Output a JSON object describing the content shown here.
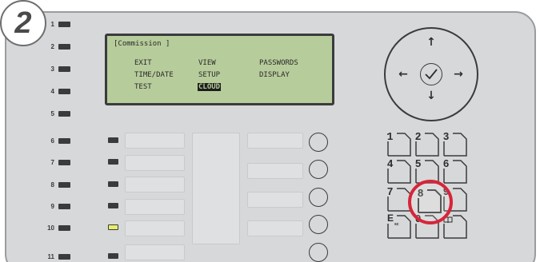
{
  "step_badge": "2",
  "status_leds": [
    {
      "label": "1"
    },
    {
      "label": "2"
    },
    {
      "label": "3"
    },
    {
      "label": "4"
    },
    {
      "label": "5"
    },
    {
      "label": "6"
    },
    {
      "label": "7"
    },
    {
      "label": "8"
    },
    {
      "label": "9"
    },
    {
      "label": "10"
    },
    {
      "label": "11"
    }
  ],
  "lcd": {
    "title": "[Commission ]",
    "menu": [
      {
        "label": "EXIT",
        "selected": false
      },
      {
        "label": "VIEW",
        "selected": false
      },
      {
        "label": "PASSWORDS",
        "selected": false
      },
      {
        "label": "TIME/DATE",
        "selected": false
      },
      {
        "label": "SETUP",
        "selected": false
      },
      {
        "label": "DISPLAY",
        "selected": false
      },
      {
        "label": "TEST",
        "selected": false
      },
      {
        "label": "CLOUD",
        "selected": true
      }
    ]
  },
  "navigation": {
    "up_icon": "arrow-up-icon",
    "down_icon": "arrow-down-icon",
    "left_icon": "arrow-left-icon",
    "right_icon": "arrow-right-icon",
    "ok_icon": "checkmark-icon"
  },
  "keypad": {
    "keys": [
      {
        "label": "1"
      },
      {
        "label": "2"
      },
      {
        "label": "3"
      },
      {
        "label": "4"
      },
      {
        "label": "5"
      },
      {
        "label": "6"
      },
      {
        "label": "7"
      },
      {
        "label": "8"
      },
      {
        "label": "9"
      },
      {
        "label": "E",
        "sub": "sc"
      },
      {
        "label": "0"
      },
      {
        "label": "",
        "icon": "book-icon"
      }
    ],
    "highlighted_key": "8"
  },
  "zone_indicator_lit": "10",
  "colors": {
    "panel": "#d7d8d9",
    "lcd_background": "#b7cc9b",
    "highlight": "#d6253a",
    "lit_led": "#e7ef6a"
  }
}
